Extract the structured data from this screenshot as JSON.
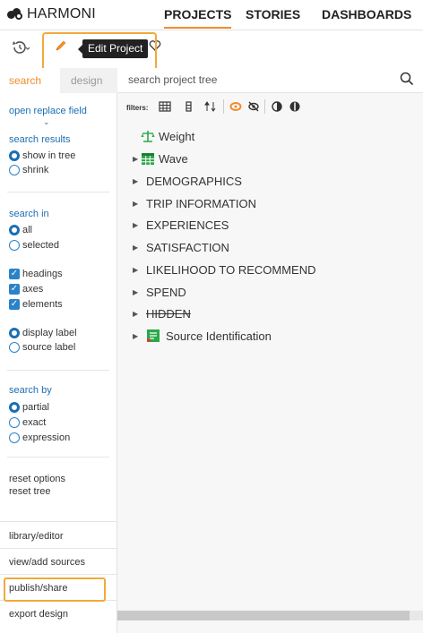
{
  "app": {
    "logo_text": "HARMONI"
  },
  "nav": {
    "projects": "PROJECTS",
    "stories": "STORIES",
    "dashboards": "DASHBOARDS"
  },
  "toolbar": {
    "tooltip": "Edit Project"
  },
  "sidebar": {
    "tabs": {
      "search": "search",
      "design": "design"
    },
    "open_replace_field": "open replace field",
    "search_results": {
      "heading": "search results",
      "options": [
        "show in tree",
        "shrink"
      ],
      "selected": "show in tree"
    },
    "search_in": {
      "heading": "search in",
      "options": [
        "all",
        "selected"
      ],
      "selected": "all",
      "checks": [
        "headings",
        "axes",
        "elements"
      ],
      "label_options": [
        "display label",
        "source label"
      ],
      "label_selected": "display label"
    },
    "search_by": {
      "heading": "search by",
      "options": [
        "partial",
        "exact",
        "expression"
      ],
      "selected": "partial"
    },
    "reset_options": "reset options",
    "reset_tree": "reset tree",
    "links": [
      "library/editor",
      "view/add sources",
      "publish/share",
      "export design"
    ]
  },
  "main": {
    "search_placeholder": "search project tree",
    "filters_label": "filters:",
    "tree": [
      {
        "label": "Weight",
        "icon": "weight-scale-icon",
        "expandable": false
      },
      {
        "label": "Wave",
        "icon": "calendar-grid-icon",
        "expandable": true
      },
      {
        "label": "DEMOGRAPHICS",
        "expandable": true
      },
      {
        "label": "TRIP INFORMATION",
        "expandable": true
      },
      {
        "label": "EXPERIENCES",
        "expandable": true
      },
      {
        "label": "SATISFACTION",
        "expandable": true
      },
      {
        "label": "LIKELIHOOD TO RECOMMEND",
        "expandable": true
      },
      {
        "label": "SPEND",
        "expandable": true
      },
      {
        "label": "HIDDEN",
        "expandable": true,
        "strikethrough": true
      },
      {
        "label": "Source Identification",
        "icon": "source-document-icon",
        "expandable": true
      }
    ]
  },
  "colors": {
    "accent": "#f28c28",
    "highlight": "#f2a93b",
    "link": "#1a6fb4",
    "tooltip_bg": "#222222"
  }
}
